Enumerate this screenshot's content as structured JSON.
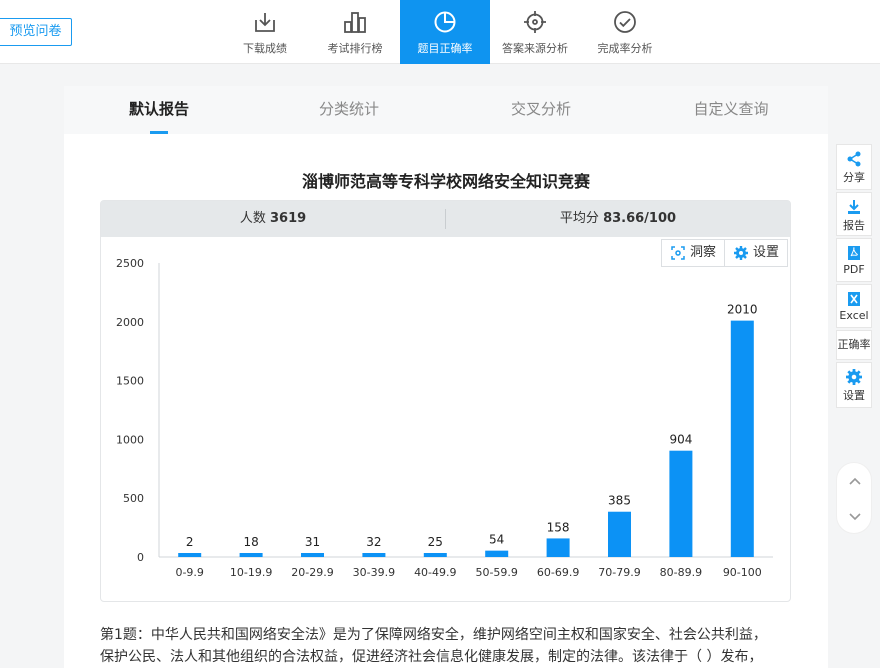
{
  "toolbar": {
    "preview_label": "预览问卷",
    "tools": [
      {
        "label": "下载成绩",
        "icon": "download-icon"
      },
      {
        "label": "考试排行榜",
        "icon": "ranking-icon"
      },
      {
        "label": "题目正确率",
        "icon": "pie-chart-icon",
        "active": true
      },
      {
        "label": "答案来源分析",
        "icon": "crosshair-icon"
      },
      {
        "label": "完成率分析",
        "icon": "check-circle-icon"
      }
    ]
  },
  "tabs": [
    {
      "label": "默认报告",
      "active": true
    },
    {
      "label": "分类统计"
    },
    {
      "label": "交叉分析"
    },
    {
      "label": "自定义查询"
    }
  ],
  "report": {
    "title": "淄博师范高等专科学校网络安全知识竞赛",
    "count_label": "人数",
    "count_value": "3619",
    "avg_label": "平均分",
    "avg_value": "83.66/100",
    "insight_label": "洞察",
    "settings_label": "设置"
  },
  "chart_data": {
    "type": "bar",
    "categories": [
      "0-9.9",
      "10-19.9",
      "20-29.9",
      "30-39.9",
      "40-49.9",
      "50-59.9",
      "60-69.9",
      "70-79.9",
      "80-89.9",
      "90-100"
    ],
    "values": [
      2,
      18,
      31,
      32,
      25,
      54,
      158,
      385,
      904,
      2010
    ],
    "ylim": [
      0,
      2500
    ],
    "yticks": [
      0,
      500,
      1000,
      1500,
      2000,
      2500
    ],
    "bar_color": "#0c92f5",
    "grid": false,
    "data_labels": true
  },
  "question": {
    "line1": "第1题：中华人民共和国网络安全法》是为了保障网络安全，维护网络空间主权和国家安全、社会公共利益，",
    "line2": "保护公民、法人和其他组织的合法权益，促进经济社会信息化健康发展，制定的法律。该法律于（ ）发布，"
  },
  "sidebar": [
    {
      "label": "分享",
      "icon": "share-icon"
    },
    {
      "label": "报告",
      "icon": "download-report-icon"
    },
    {
      "label": "PDF",
      "icon": "pdf-icon"
    },
    {
      "label": "Excel",
      "icon": "excel-icon"
    },
    {
      "label": "正确率",
      "icon": ""
    },
    {
      "label": "设置",
      "icon": "gear-icon"
    }
  ],
  "colors": {
    "accent": "#1a9bf0",
    "active_tab_bg": "#0f94f0"
  }
}
